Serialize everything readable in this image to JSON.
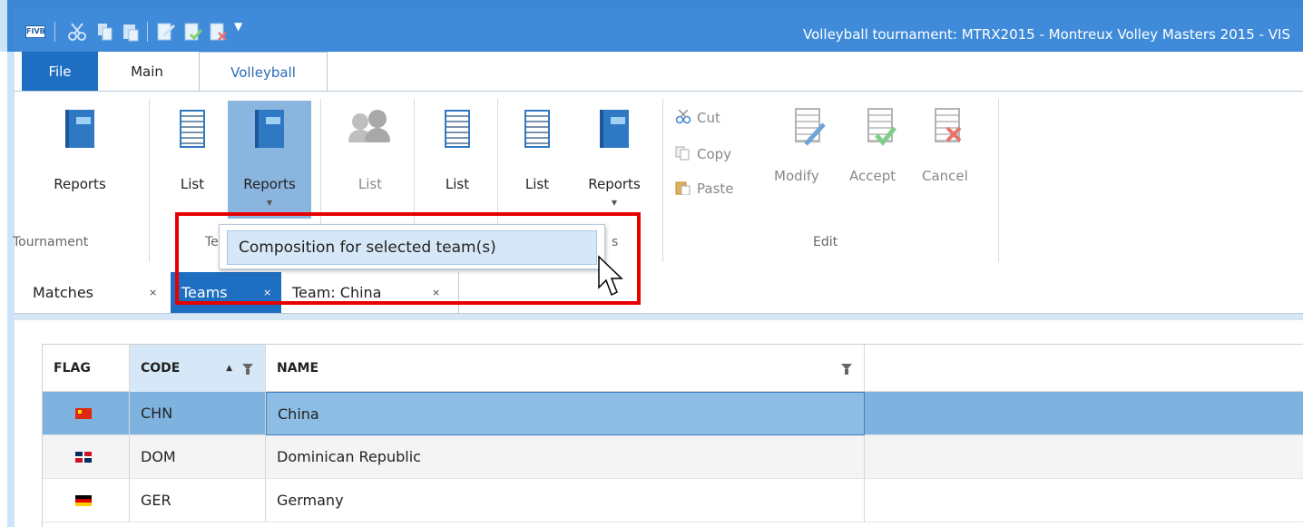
{
  "window": {
    "title": "Volleyball tournament: MTRX2015 - Montreux Volley Masters 2015 - VIS"
  },
  "quick_access": [
    "app-icon",
    "cut-icon",
    "copy-icon",
    "paste-icon",
    "edit-doc-icon",
    "accept-doc-icon",
    "delete-doc-icon",
    "customize-arrow-icon"
  ],
  "ribbon_tabs": [
    {
      "label": "File"
    },
    {
      "label": "Main"
    },
    {
      "label": "Volleyball"
    }
  ],
  "ribbon": {
    "groups": {
      "tournament": {
        "label": "Tournament",
        "reports": "Reports"
      },
      "teams": {
        "label": "Tea",
        "list": "List",
        "reports": "Reports"
      },
      "g3": {
        "list": "List"
      },
      "g4": {
        "list": "List"
      },
      "g5": {
        "label": "s",
        "list": "List",
        "reports": "Reports"
      },
      "edit": {
        "label": "Edit",
        "cut": "Cut",
        "copy": "Copy",
        "paste": "Paste",
        "modify": "Modify",
        "accept": "Accept",
        "cancel": "Cancel"
      }
    }
  },
  "dropdown": {
    "item": "Composition for selected team(s)"
  },
  "doc_tabs": [
    {
      "label": "Matches",
      "close": "×"
    },
    {
      "label": "Teams",
      "close": "×"
    },
    {
      "label": "Team: China",
      "close": "×"
    }
  ],
  "grid": {
    "headers": {
      "flag": "FLAG",
      "code": "CODE",
      "name": "NAME"
    },
    "sort_indicator": "▲",
    "rows": [
      {
        "code": "CHN",
        "name": "China",
        "flag_colors": [
          "#de2910",
          "#ffde00"
        ]
      },
      {
        "code": "DOM",
        "name": "Dominican Republic",
        "flag_colors": [
          "#002d62",
          "#ce1126"
        ]
      },
      {
        "code": "GER",
        "name": "Germany",
        "flag_colors": [
          "#000000",
          "#dd0000",
          "#ffce00"
        ]
      }
    ]
  },
  "colors": {
    "accent": "#1e6fc1",
    "selection": "#7fb3df",
    "highlight_box": "#e60000"
  }
}
